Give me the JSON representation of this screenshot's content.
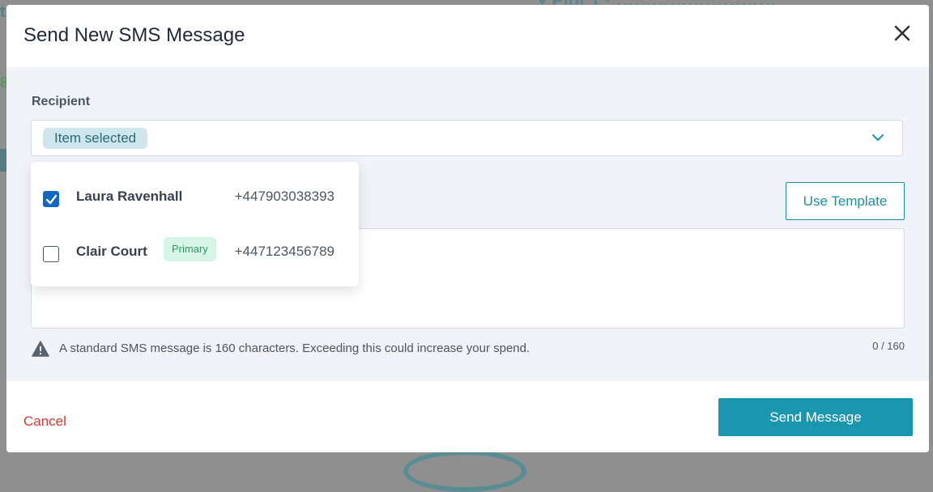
{
  "modal": {
    "title": "Send New SMS Message",
    "recipient_label": "Recipient",
    "selected_chip": "Item selected",
    "use_template_label": "Use Template",
    "message_placeholder": "",
    "sms_warning": "A standard SMS message is 160 characters. Exceeding this could increase your spend.",
    "char_counter": "0 / 160",
    "cancel_label": "Cancel",
    "send_label": "Send Message"
  },
  "recipients": [
    {
      "name": "Laura Ravenhall",
      "phone": "+447903038393",
      "checked": true,
      "badge": ""
    },
    {
      "name": "Clair Court",
      "phone": "+447123456789",
      "checked": false,
      "badge": "Primary"
    }
  ],
  "colors": {
    "accent": "#1a96ae",
    "checkbox_checked": "#1466c3",
    "cancel": "#d43a3a",
    "badge_bg": "#d6f5e6",
    "badge_text": "#2c9a66",
    "body_bg": "#f0f3f8"
  },
  "icons": [
    "close-icon",
    "chevron-down-icon",
    "check-icon",
    "warning-icon"
  ]
}
